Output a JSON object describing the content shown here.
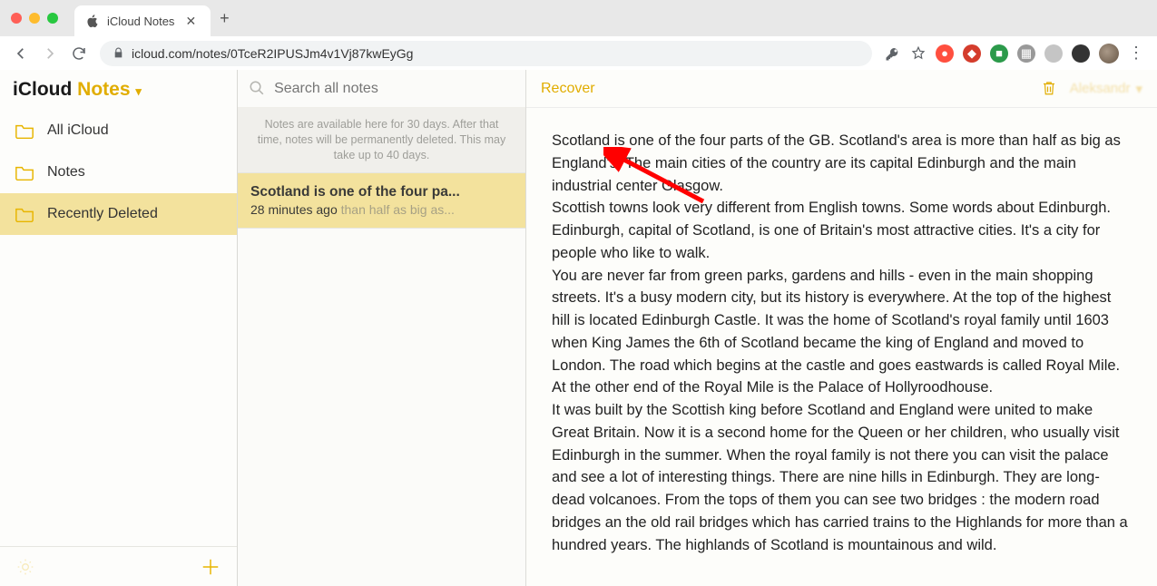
{
  "browser": {
    "tab_title": "iCloud Notes",
    "url": "icloud.com/notes/0TceR2IPUSJm4v1Vj87kwEyGg"
  },
  "app": {
    "title_prefix": "iCloud ",
    "title_word": "Notes"
  },
  "sidebar": {
    "folders": [
      {
        "label": "All iCloud"
      },
      {
        "label": "Notes"
      },
      {
        "label": "Recently Deleted"
      }
    ]
  },
  "search": {
    "placeholder": "Search all notes"
  },
  "banner": {
    "text": "Notes are available here for 30 days. After that time, notes will be permanently deleted. This may take up to 40 days."
  },
  "notes": [
    {
      "title": "Scotland is one of the four pa...",
      "time": "28 minutes ago",
      "preview": "than half as big as..."
    }
  ],
  "toolbar": {
    "recover_label": "Recover",
    "user_label": "Aleksandr"
  },
  "note_body": {
    "p1": "Scotland is one of the four parts of the GB. Scotland's area is more than half as big as England's. The main cities of the country are its capital Edinburgh and the main industrial center Glasgow.",
    "p2": "Scottish towns look very different from English towns. Some words about Edinburgh. Edinburgh, capital of Scotland, is one of Britain's most attractive cities. It's a city for people who like to walk.",
    "p3": "You are never far from green parks, gardens and hills - even in the main shopping streets. It's a busy modern city, but its history is everywhere. At the top of the highest hill is located Edinburgh Castle. It was the home of Scotland's royal family until 1603 when King James the 6th of Scotland became the king of England and moved to London. The road which begins at the castle and goes eastwards is called Royal Mile. At the other end of the Royal Mile is the Palace of Hollyroodhouse.",
    "p4": "It was built by the Scottish king before Scotland and England were united to make Great Britain. Now it is a second home for the Queen or her children, who usually visit Edinburgh in the summer. When the royal family is not there you can visit the palace and see a lot of interesting things. There are nine hills in Edinburgh. They are long-dead volcanoes. From the tops of them you can see two bridges : the modern road bridges an the old rail bridges which has carried trains to the Highlands for more than a hundred years. The highlands of Scotland is mountainous and wild."
  }
}
